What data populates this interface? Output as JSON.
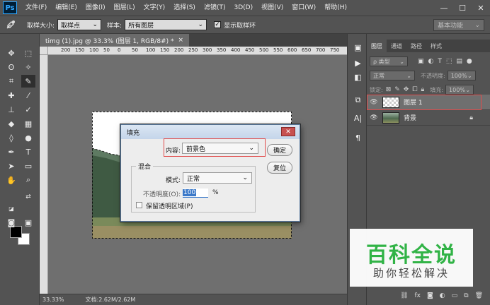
{
  "app": {
    "logo": "Ps"
  },
  "menu": [
    "文件(F)",
    "编辑(E)",
    "图像(I)",
    "图层(L)",
    "文字(Y)",
    "选择(S)",
    "滤镜(T)",
    "3D(D)",
    "视图(V)",
    "窗口(W)",
    "帮助(H)"
  ],
  "window_controls": {
    "minimize": "—",
    "restore": "☐",
    "close": "✕"
  },
  "options": {
    "tool_icon": "eyedropper-icon",
    "sample_size_label": "取样大小:",
    "sample_size_value": "取样点",
    "sample_label": "样本:",
    "sample_value": "所有图层",
    "show_ring_label": "显示取样环",
    "show_ring_checked": true,
    "workspace": "基本功能"
  },
  "document": {
    "tab_title": "timg (1).jpg @ 33.3% (图层 1, RGB/8#) *",
    "tab_close": "×",
    "ruler_ticks": [
      "200",
      "150",
      "100",
      "50",
      "0",
      "50",
      "100",
      "150",
      "200",
      "250",
      "300",
      "350",
      "400",
      "450",
      "500",
      "550",
      "600",
      "650",
      "700",
      "750"
    ],
    "zoom": "33.33%",
    "doc_info": "文档:2.62M/2.62M"
  },
  "dialog": {
    "title": "填充",
    "close": "✕",
    "content_label": "内容:",
    "content_value": "前景色",
    "ok": "确定",
    "reset": "复位",
    "blend_group": "混合",
    "mode_label": "模式:",
    "mode_value": "正常",
    "opacity_label": "不透明度(O):",
    "opacity_value": "100",
    "opacity_unit": "%",
    "preserve_label": "保留透明区域(P)"
  },
  "layers_panel": {
    "tabs": [
      "图层",
      "通道",
      "路径",
      "样式"
    ],
    "filter_value": "ρ 类型",
    "blend_value": "正常",
    "opacity_label": "不透明度:",
    "opacity_value": "100%",
    "lock_label": "锁定:",
    "fill_label": "填充:",
    "fill_value": "100%",
    "layers": [
      {
        "name": "图层 1",
        "selected": true,
        "locked": false
      },
      {
        "name": "背景",
        "selected": false,
        "locked": true
      }
    ],
    "footer_icons": [
      "link-icon",
      "fx-icon",
      "mask-icon",
      "adjustment-icon",
      "group-icon",
      "new-layer-icon",
      "delete-icon"
    ],
    "fx_text": "fx"
  },
  "watermark": {
    "title": "百科全说",
    "subtitle": "助你轻松解决"
  },
  "colors": {
    "highlight": "#e14b4b",
    "watermark_green": "#31b346"
  }
}
